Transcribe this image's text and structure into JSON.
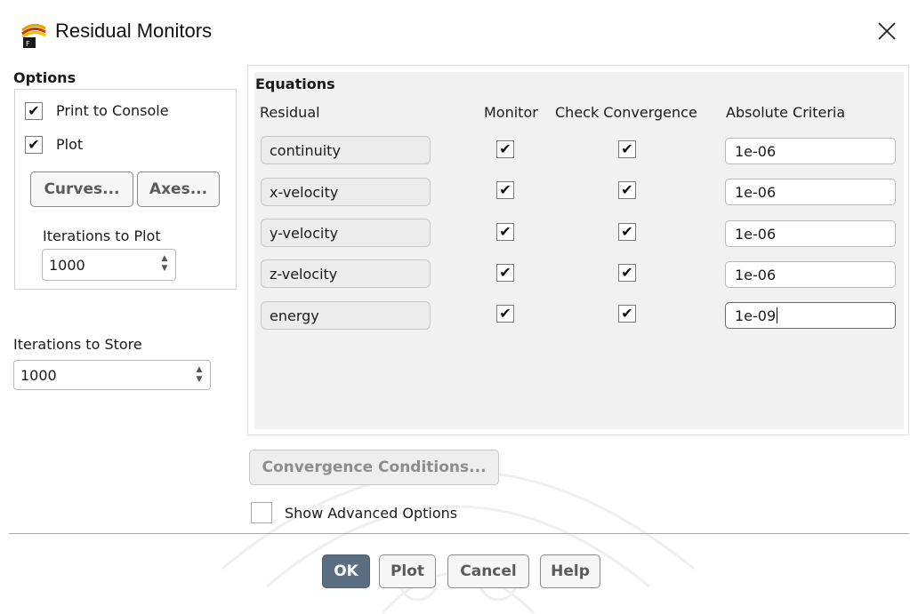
{
  "window": {
    "title": "Residual Monitors",
    "icon": "fluent-app-icon",
    "close_icon": "close-icon"
  },
  "options": {
    "label": "Options",
    "print_to_console": {
      "label": "Print to Console",
      "checked": true
    },
    "plot": {
      "label": "Plot",
      "checked": true
    },
    "curves_button": "Curves...",
    "axes_button": "Axes...",
    "iterations_to_plot": {
      "label": "Iterations to Plot",
      "value": "1000"
    }
  },
  "iterations_to_store": {
    "label": "Iterations to Store",
    "value": "1000"
  },
  "equations": {
    "label": "Equations",
    "columns": {
      "residual": "Residual",
      "monitor": "Monitor",
      "check": "Check Convergence",
      "criteria": "Absolute Criteria"
    },
    "rows": [
      {
        "residual": "continuity",
        "monitor": true,
        "check": true,
        "criteria": "1e-06"
      },
      {
        "residual": "x-velocity",
        "monitor": true,
        "check": true,
        "criteria": "1e-06"
      },
      {
        "residual": "y-velocity",
        "monitor": true,
        "check": true,
        "criteria": "1e-06"
      },
      {
        "residual": "z-velocity",
        "monitor": true,
        "check": true,
        "criteria": "1e-06"
      },
      {
        "residual": "energy",
        "monitor": true,
        "check": true,
        "criteria": "1e-09"
      }
    ]
  },
  "convergence_conditions_button": "Convergence Conditions...",
  "show_advanced": {
    "label": "Show Advanced Options",
    "checked": false
  },
  "buttons": {
    "ok": "OK",
    "plot": "Plot",
    "cancel": "Cancel",
    "help": "Help"
  },
  "colors": {
    "ok_button": "#5a6d81",
    "panel_bg": "#f1f1f1"
  },
  "check_glyph": "✔"
}
